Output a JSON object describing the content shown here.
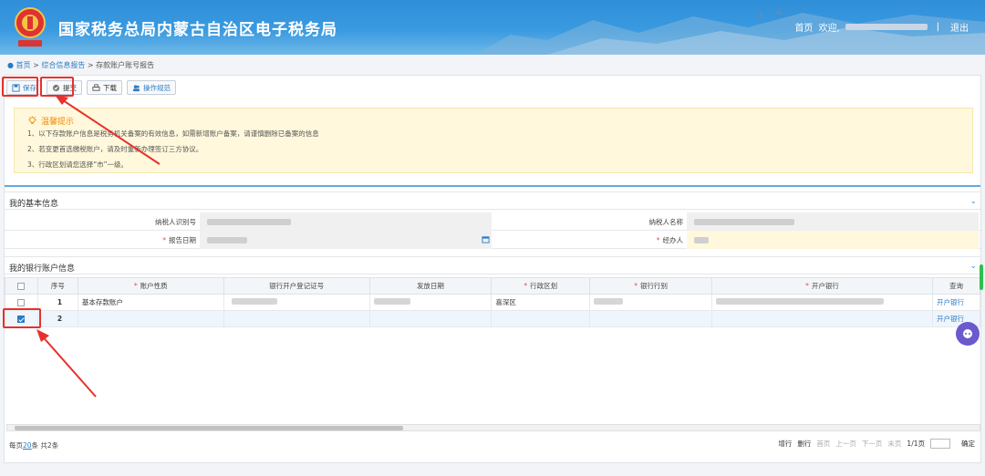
{
  "header": {
    "site_title": "国家税务总局内蒙古自治区电子税务局",
    "home_link": "首页",
    "welcome": "欢迎,",
    "separator": "|",
    "logout": "退出",
    "logo_text": "中国税务"
  },
  "breadcrumb": {
    "home": "首页",
    "sep1": ">",
    "level2": "综合信息报告",
    "sep2": ">",
    "current": "存款账户账号报告"
  },
  "toolbar": {
    "save_label": "保存",
    "submit_label": "提交",
    "download_label": "下载",
    "guide_label": "操作规范"
  },
  "tips": {
    "title": "温馨提示",
    "line1": "1、以下存款账户信息是税务机关备案的有效信息，如需新增账户备案，请谨慎删除已备案的信息",
    "line2": "2、若变更首选缴税账户，请及时重新办理签订三方协议。",
    "line3": "3、行政区划请您选择“市”一级。"
  },
  "basic_info": {
    "section_title": "我的基本信息",
    "taxpayer_id_label": "纳税人识别号",
    "taxpayer_name_label": "纳税人名称",
    "report_date_label": "报告日期",
    "handler_label": "经办人",
    "required_mark": "*"
  },
  "bank_info": {
    "section_title": "我的银行账户信息",
    "columns": [
      "序号",
      "账户性质",
      "银行开户登记证号",
      "发放日期",
      "行政区划",
      "银行行别",
      "开户银行",
      "查询"
    ],
    "required_columns": [
      false,
      true,
      false,
      false,
      true,
      true,
      true,
      false
    ],
    "rows": [
      {
        "no": "1",
        "account_type": "基本存款账户",
        "region": "喜深区",
        "checked": false
      },
      {
        "no": "2",
        "account_type": "",
        "region": "",
        "checked": true
      }
    ],
    "query_link": "开户银行"
  },
  "pager": {
    "per_page_prefix": "每页",
    "per_page_value": "20",
    "per_page_suffix": "条 共2条",
    "add_row": "增行",
    "delete_row": "删行",
    "first": "首页",
    "prev": "上一页",
    "next": "下一页",
    "last": "末页",
    "page_info": "1/1页",
    "confirm": "确定"
  },
  "colors": {
    "header_blue": "#2f8ed8",
    "annotation_red": "#e8312b",
    "link_blue": "#2a7bc6",
    "tips_bg": "#fff8dc"
  }
}
